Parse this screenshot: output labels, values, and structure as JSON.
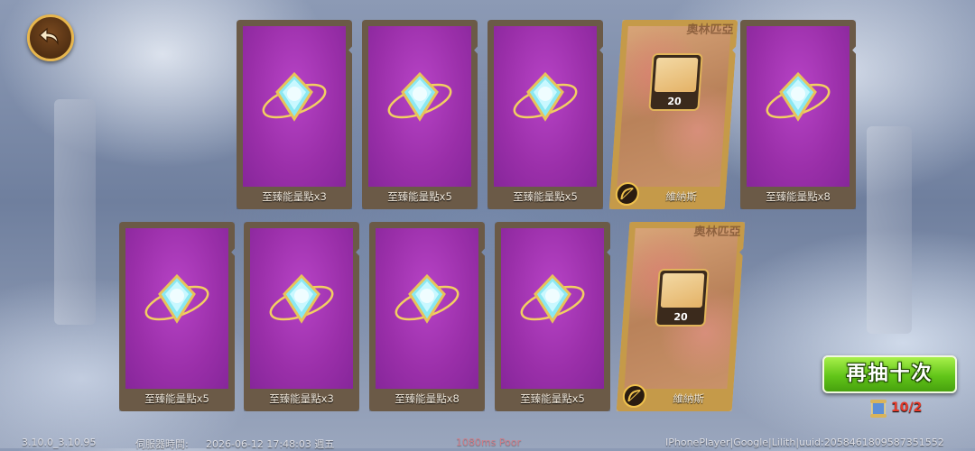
{
  "navigation": {
    "back_icon": "back-arrow-icon"
  },
  "cards": [
    {
      "type": "item",
      "icon": "energy-crystal-icon",
      "label": "至臻能量點x3"
    },
    {
      "type": "item",
      "icon": "energy-crystal-icon",
      "label": "至臻能量點x5"
    },
    {
      "type": "item",
      "icon": "energy-crystal-icon",
      "label": "至臻能量點x5"
    },
    {
      "type": "hero",
      "faction": "奧林匹亞",
      "count": "20",
      "class_icon": "bow-class-icon",
      "label": "維納斯"
    },
    {
      "type": "item",
      "icon": "energy-crystal-icon",
      "label": "至臻能量點x8"
    },
    {
      "type": "item",
      "icon": "energy-crystal-icon",
      "label": "至臻能量點x5"
    },
    {
      "type": "item",
      "icon": "energy-crystal-icon",
      "label": "至臻能量點x3"
    },
    {
      "type": "item",
      "icon": "energy-crystal-icon",
      "label": "至臻能量點x8"
    },
    {
      "type": "item",
      "icon": "energy-crystal-icon",
      "label": "至臻能量點x5"
    },
    {
      "type": "hero",
      "faction": "奧林匹亞",
      "count": "20",
      "class_icon": "bow-class-icon",
      "label": "維納斯"
    }
  ],
  "actions": {
    "reroll_label": "再抽十次",
    "scroll_icon": "summon-scroll-icon",
    "scroll_count": "10/2"
  },
  "status_bar": {
    "version": "3.10.0_3.10.95",
    "server_time_label": "伺服器時間:",
    "server_time": "2026-06-12  17:48:03  週五",
    "ping": "1080ms Poor",
    "device_info": "IPhonePlayer|Google|Lilith|uuid:2058461809587351552"
  },
  "colors": {
    "card_purple": "#9a2fa9",
    "card_frame": "#6b5a47",
    "hero_glow": "#ffc450",
    "button_green": "#62c519",
    "counter_red": "#e53a2a"
  }
}
